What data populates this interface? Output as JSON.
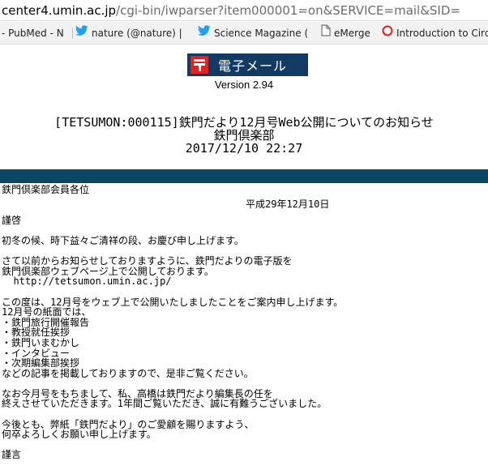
{
  "address_bar": {
    "host": "center4.umin.ac.jp",
    "path": "/cgi-bin/iwparser?item000001=on&SERVICE=mail&SID="
  },
  "bookmarks": [
    {
      "label": "- PubMed - N",
      "icon": "none"
    },
    {
      "label": "nature (@nature) |",
      "icon": "twitter-bird-icon"
    },
    {
      "label": "Science Magazine (",
      "icon": "twitter-bird-icon"
    },
    {
      "label": "eMerge",
      "icon": "document-icon"
    },
    {
      "label": "Introduction to Circ",
      "icon": "red-circle-icon"
    }
  ],
  "header": {
    "logo_text": "電子メール",
    "version": "Version 2.94"
  },
  "message": {
    "subject": "[TETSUMON:000115]鉄門だより12月号Web公開についてのお知らせ",
    "sender": "鉄門倶楽部",
    "datetime": "2017/12/10 22:27"
  },
  "body": {
    "addressee": "鉄門倶楽部会員各位",
    "date": "平成29年12月10日",
    "greeting": "謹啓",
    "p1": "初冬の候、時下益々ご清祥の段、お慶び申し上げます。",
    "p2_line1": "さて以前からお知らせしておりますように、鉄門だよりの電子版を",
    "p2_line2": "鉄門倶楽部ウェブページ上で公開しております。",
    "url": "  http://tetsumon.umin.ac.jp/",
    "p3_line1": "この度は、12月号をウェブ上で公開いたしましたことをご案内申し上げます。",
    "p3_line2": "12月号の紙面では、",
    "items": [
      "・鉄門旅行開催報告",
      "・教授就任挨拶",
      "・鉄門いまむかし",
      "・インタビュー",
      "・次期編集部挨拶"
    ],
    "p3_end": "などの記事を掲載しておりますので、是非ご覧ください。",
    "p4_line1": "なお今月号をもちまして、私、高橋は鉄門だより編集長の任を",
    "p4_line2": "終えさせていただきます。1年間ご覧いただき、誠に有難うございました。",
    "p5_line1": "今後とも、弊紙「鉄門だより」のご愛顧を賜りますよう、",
    "p5_line2": "何卒よろしくお願い申し上げます。",
    "closing": "謹言"
  },
  "colors": {
    "header_bar": "#123a63",
    "divider": "#0c4468",
    "logo_mark": "#e0231f"
  }
}
